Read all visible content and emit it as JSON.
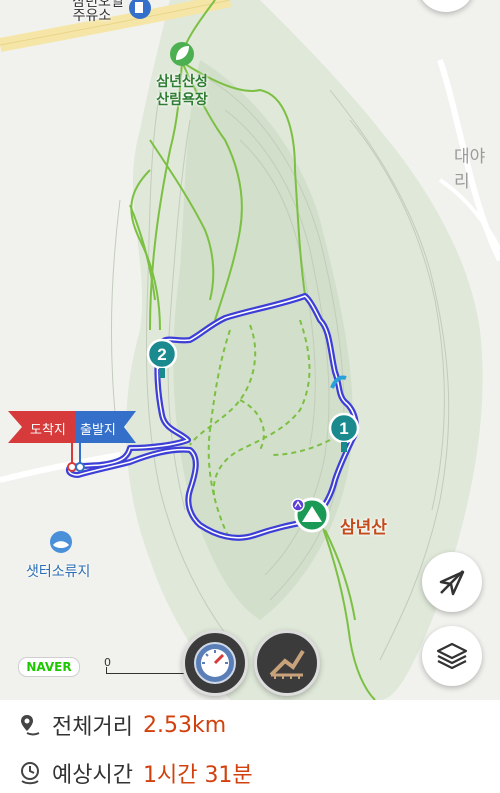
{
  "map": {
    "labels": {
      "gas_station_partial": "삼년오일",
      "gas_station": "주유소",
      "forest_bath_line1": "삼년산성",
      "forest_bath_line2": "산림욕장",
      "area_partial": "대야리",
      "peak": "삼년산",
      "shelter": "샛터소류지",
      "arrival_flag": "도착지",
      "departure_flag": "출발지"
    },
    "waypoints": [
      "1",
      "2"
    ],
    "brand": "NAVER",
    "scale_label": "0",
    "colors": {
      "route": "#3d3fd6",
      "trail": "#7cc043",
      "mountain": "#d9e4d2",
      "marker": "#1a8a8f",
      "arrival": "#d63a3a",
      "departure": "#3470c9"
    }
  },
  "controls": {
    "compass_icon": "compass-icon",
    "elevation_icon": "elevation-profile-icon",
    "location_icon": "location-off-icon",
    "layers_icon": "layers-icon"
  },
  "info": {
    "distance_label": "전체거리",
    "distance_value": "2.53km",
    "time_label": "예상시간",
    "time_value": "1시간 31분"
  }
}
